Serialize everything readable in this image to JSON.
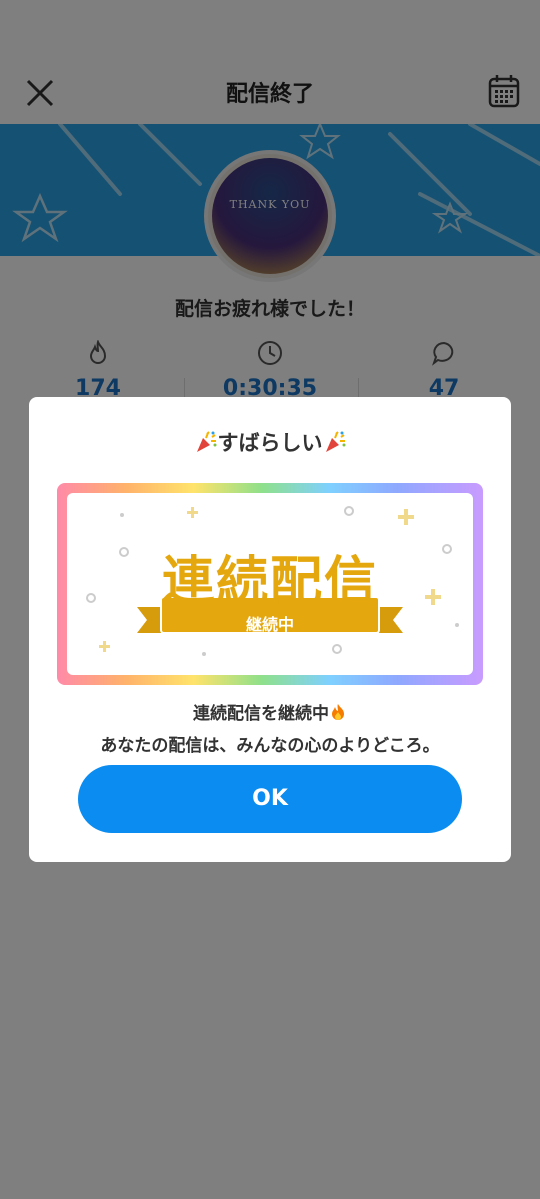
{
  "header": {
    "title": "配信終了",
    "close_icon": "close-icon",
    "calendar_icon": "calendar-icon"
  },
  "profile": {
    "avatar_text": "THANK YOU",
    "greeting": "配信お疲れ様でした！"
  },
  "stats": [
    {
      "icon": "fire-icon",
      "value": "174"
    },
    {
      "icon": "clock-icon",
      "value": "0:30:35"
    },
    {
      "icon": "chat-bubble-icon",
      "value": "47"
    }
  ],
  "modal": {
    "title": "すばらしい",
    "badge_main": "連続配信",
    "badge_ribbon": "継続中",
    "message_line1": "連続配信を継続中",
    "message_line2": "あなたの配信は、みんなの心のよりどころ。",
    "ok_label": "OK"
  },
  "colors": {
    "accent": "#0a8cf0",
    "badge_gold": "#e5a70e",
    "banner": "#29a3e6"
  }
}
